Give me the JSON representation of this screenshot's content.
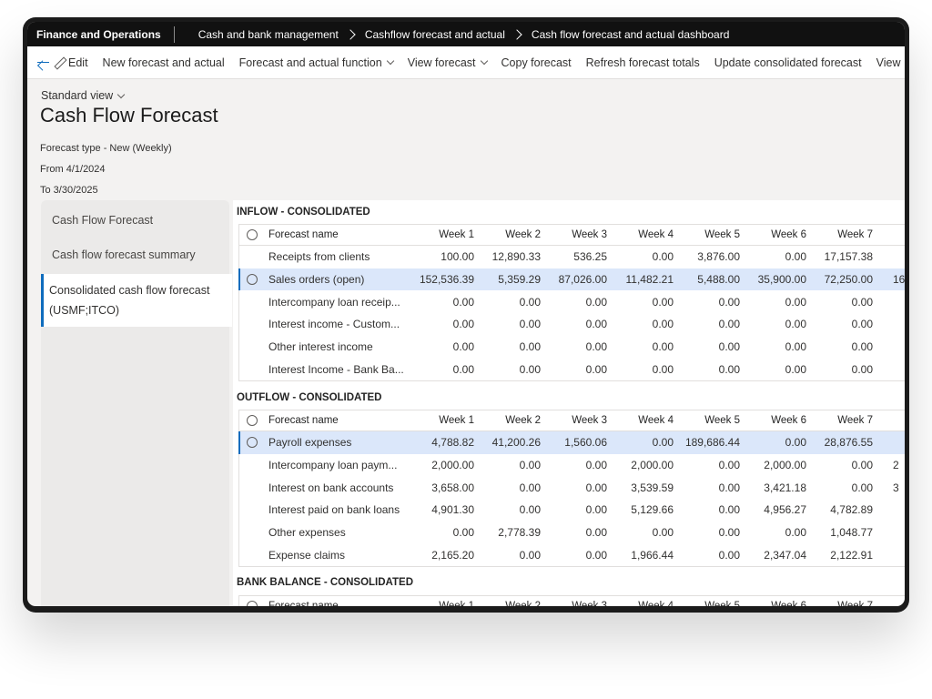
{
  "topbar": {
    "app_name": "Finance and Operations",
    "breadcrumbs": [
      "Cash and bank management",
      "Cashflow forecast and actual",
      "Cash flow forecast and actual dashboard"
    ]
  },
  "actions": {
    "edit": "Edit",
    "new_forecast": "New forecast and actual",
    "forecast_function": "Forecast and actual function",
    "view_forecast": "View forecast",
    "copy_forecast": "Copy forecast",
    "refresh_totals": "Refresh forecast totals",
    "update_consolidated": "Update consolidated forecast",
    "view_overflow": "View"
  },
  "header": {
    "view_selector": "Standard view",
    "title": "Cash Flow Forecast",
    "forecast_type": "Forecast type - New (Weekly)",
    "from": "From 4/1/2024",
    "to": "To 3/30/2025"
  },
  "sidebar": {
    "items": [
      {
        "label": "Cash Flow Forecast"
      },
      {
        "label": "Cash flow forecast summary"
      },
      {
        "label_line1": "Consolidated cash flow forecast",
        "label_line2": "(USMF;ITCO)"
      }
    ]
  },
  "columns": [
    "Forecast name",
    "Week 1",
    "Week 2",
    "Week 3",
    "Week 4",
    "Week 5",
    "Week 6",
    "Week 7"
  ],
  "inflow": {
    "title": "INFLOW - CONSOLIDATED",
    "rows": [
      {
        "name": "Receipts from clients",
        "v": [
          "100.00",
          "12,890.33",
          "536.25",
          "0.00",
          "3,876.00",
          "0.00",
          "17,157.38"
        ],
        "extra": ""
      },
      {
        "name": "Sales orders (open)",
        "v": [
          "152,536.39",
          "5,359.29",
          "87,026.00",
          "11,482.21",
          "5,488.00",
          "35,900.00",
          "72,250.00"
        ],
        "extra": "16"
      },
      {
        "name": "Intercompany loan receip...",
        "v": [
          "0.00",
          "0.00",
          "0.00",
          "0.00",
          "0.00",
          "0.00",
          "0.00"
        ],
        "extra": ""
      },
      {
        "name": "Interest income - Custom...",
        "v": [
          "0.00",
          "0.00",
          "0.00",
          "0.00",
          "0.00",
          "0.00",
          "0.00"
        ],
        "extra": ""
      },
      {
        "name": "Other interest income",
        "v": [
          "0.00",
          "0.00",
          "0.00",
          "0.00",
          "0.00",
          "0.00",
          "0.00"
        ],
        "extra": ""
      },
      {
        "name": "Interest Income - Bank Ba...",
        "v": [
          "0.00",
          "0.00",
          "0.00",
          "0.00",
          "0.00",
          "0.00",
          "0.00"
        ],
        "extra": ""
      }
    ]
  },
  "outflow": {
    "title": "OUTFLOW - CONSOLIDATED",
    "rows": [
      {
        "name": "Payroll expenses",
        "v": [
          "4,788.82",
          "41,200.26",
          "1,560.06",
          "0.00",
          "189,686.44",
          "0.00",
          "28,876.55"
        ],
        "extra": ""
      },
      {
        "name": "Intercompany loan paym...",
        "v": [
          "2,000.00",
          "0.00",
          "0.00",
          "2,000.00",
          "0.00",
          "2,000.00",
          "0.00"
        ],
        "extra": "2"
      },
      {
        "name": "Interest on bank accounts",
        "v": [
          "3,658.00",
          "0.00",
          "0.00",
          "3,539.59",
          "0.00",
          "3,421.18",
          "0.00"
        ],
        "extra": "3"
      },
      {
        "name": "Interest paid on bank loans",
        "v": [
          "4,901.30",
          "0.00",
          "0.00",
          "5,129.66",
          "0.00",
          "4,956.27",
          "4,782.89"
        ],
        "extra": ""
      },
      {
        "name": "Other expenses",
        "v": [
          "0.00",
          "2,778.39",
          "0.00",
          "0.00",
          "0.00",
          "0.00",
          "1,048.77"
        ],
        "extra": ""
      },
      {
        "name": "Expense claims",
        "v": [
          "2,165.20",
          "0.00",
          "0.00",
          "1,966.44",
          "0.00",
          "2,347.04",
          "2,122.91"
        ],
        "extra": ""
      }
    ]
  },
  "bank_balance": {
    "title": "BANK BALANCE - CONSOLIDATED"
  }
}
